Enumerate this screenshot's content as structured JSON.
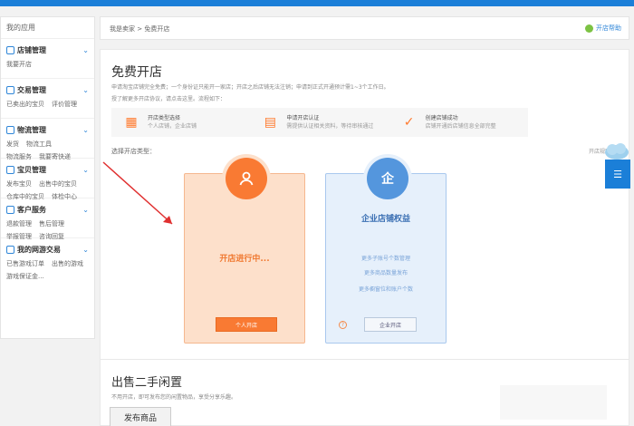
{
  "colors": {
    "brand": "#1b7fd8",
    "personal_accent": "#f97a33",
    "enterprise_accent": "#5496dd"
  },
  "sidebar": {
    "header": "我的应用",
    "groups": [
      {
        "title": "店铺管理",
        "icon": "store-icon",
        "links": [
          "我要开店"
        ]
      },
      {
        "title": "交易管理",
        "icon": "trade-icon",
        "links": [
          "已卖出的宝贝",
          "评价管理"
        ]
      },
      {
        "title": "物流管理",
        "icon": "truck-icon",
        "links": [
          "发货",
          "物流工具"
        ],
        "links2": [
          "物流服务",
          "我要寄快递"
        ]
      },
      {
        "title": "宝贝管理",
        "icon": "goods-icon",
        "links": [
          "发布宝贝",
          "出售中的宝贝"
        ],
        "links2": [
          "仓库中的宝贝",
          "体检中心"
        ]
      },
      {
        "title": "客户服务",
        "icon": "service-icon",
        "links": [
          "退款管理",
          "售后管理"
        ],
        "links2": [
          "举报管理",
          "咨询回复"
        ]
      },
      {
        "title": "我的网游交易",
        "icon": "game-icon",
        "links": [
          "已售游戏订单",
          "出售的游戏"
        ],
        "links2": [
          "游戏保证金..."
        ]
      }
    ]
  },
  "breadcrumb": "我是卖家 > 免费开店",
  "help": {
    "label": "开店帮助"
  },
  "panel": {
    "title": "免费开店",
    "desc": "申请淘宝店铺完全免费；一个身份证只能开一家店；开店之后店铺无法注销；申请到正式开通预计需1~3个工作日。",
    "desc2": "授了解更多开店协议，请点击这里。流程如下：",
    "steps": [
      {
        "title": "开店类型选择",
        "sub": "个人店铺，企业店铺",
        "icon": "grid-icon"
      },
      {
        "title": "申请开店认证",
        "sub": "需提供认证相关资料，等待审核通过",
        "icon": "document-icon"
      },
      {
        "title": "创建店铺成功",
        "sub": "店铺开通后店铺信息全部完整",
        "icon": "check-icon"
      }
    ],
    "choose_label": "选择开店类型：",
    "rules_link": "开店规则必看",
    "personal": {
      "status": "开店进行中...",
      "button": "个人开店"
    },
    "enterprise": {
      "badge": "企",
      "title": "企业店铺权益",
      "lines": [
        "更多子账号个数管理",
        "更多商品数量发布",
        "更多橱窗位和账户个数"
      ],
      "button": "企业开店"
    }
  },
  "second": {
    "title": "出售二手闲置",
    "desc": "不用开店，即可发布您的闲置物品，享受分享乐趣。",
    "button": "发布商品"
  }
}
